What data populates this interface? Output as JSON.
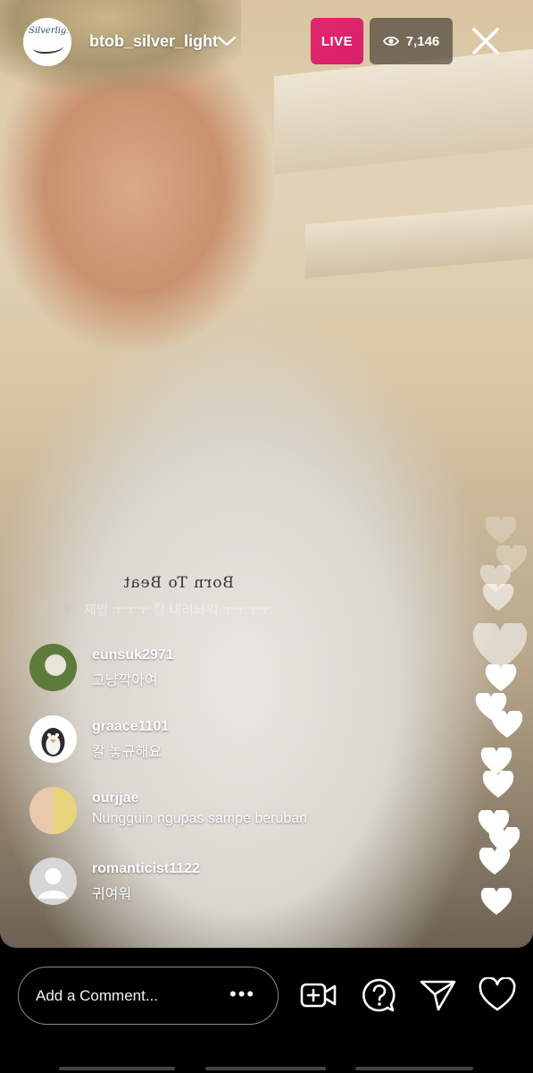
{
  "header": {
    "username": "btob_silver_light",
    "avatar_label": "Silverlight",
    "live_label": "LIVE",
    "viewer_count": "7,146"
  },
  "video": {
    "shirt_text": "Born To Beat"
  },
  "faded_comment": {
    "text": "제발 ㅜㅜㅜ 칼 내려놔워 ㅜㅜㅜㅜ"
  },
  "comments": [
    {
      "username": "eunsuk2971",
      "message": "그냥깍아여"
    },
    {
      "username": "graace1101",
      "message": "칼 놓규해요"
    },
    {
      "username": "ourjjae",
      "message": "Nungguin ngupas sampe beruban"
    },
    {
      "username": "romanticist1122",
      "message": "귀여워"
    }
  ],
  "bottom": {
    "comment_placeholder": "Add a Comment...",
    "more_label": "•••"
  },
  "colors": {
    "live": "#d8206a",
    "viewer_bg": "rgba(70,60,50,.68)",
    "background": "#000000"
  },
  "icons": {
    "close": "close-icon",
    "eye": "eye-icon",
    "chevron": "chevron-down-icon",
    "add_video": "add-video-icon",
    "question": "question-icon",
    "send": "send-icon",
    "like": "heart-icon"
  }
}
